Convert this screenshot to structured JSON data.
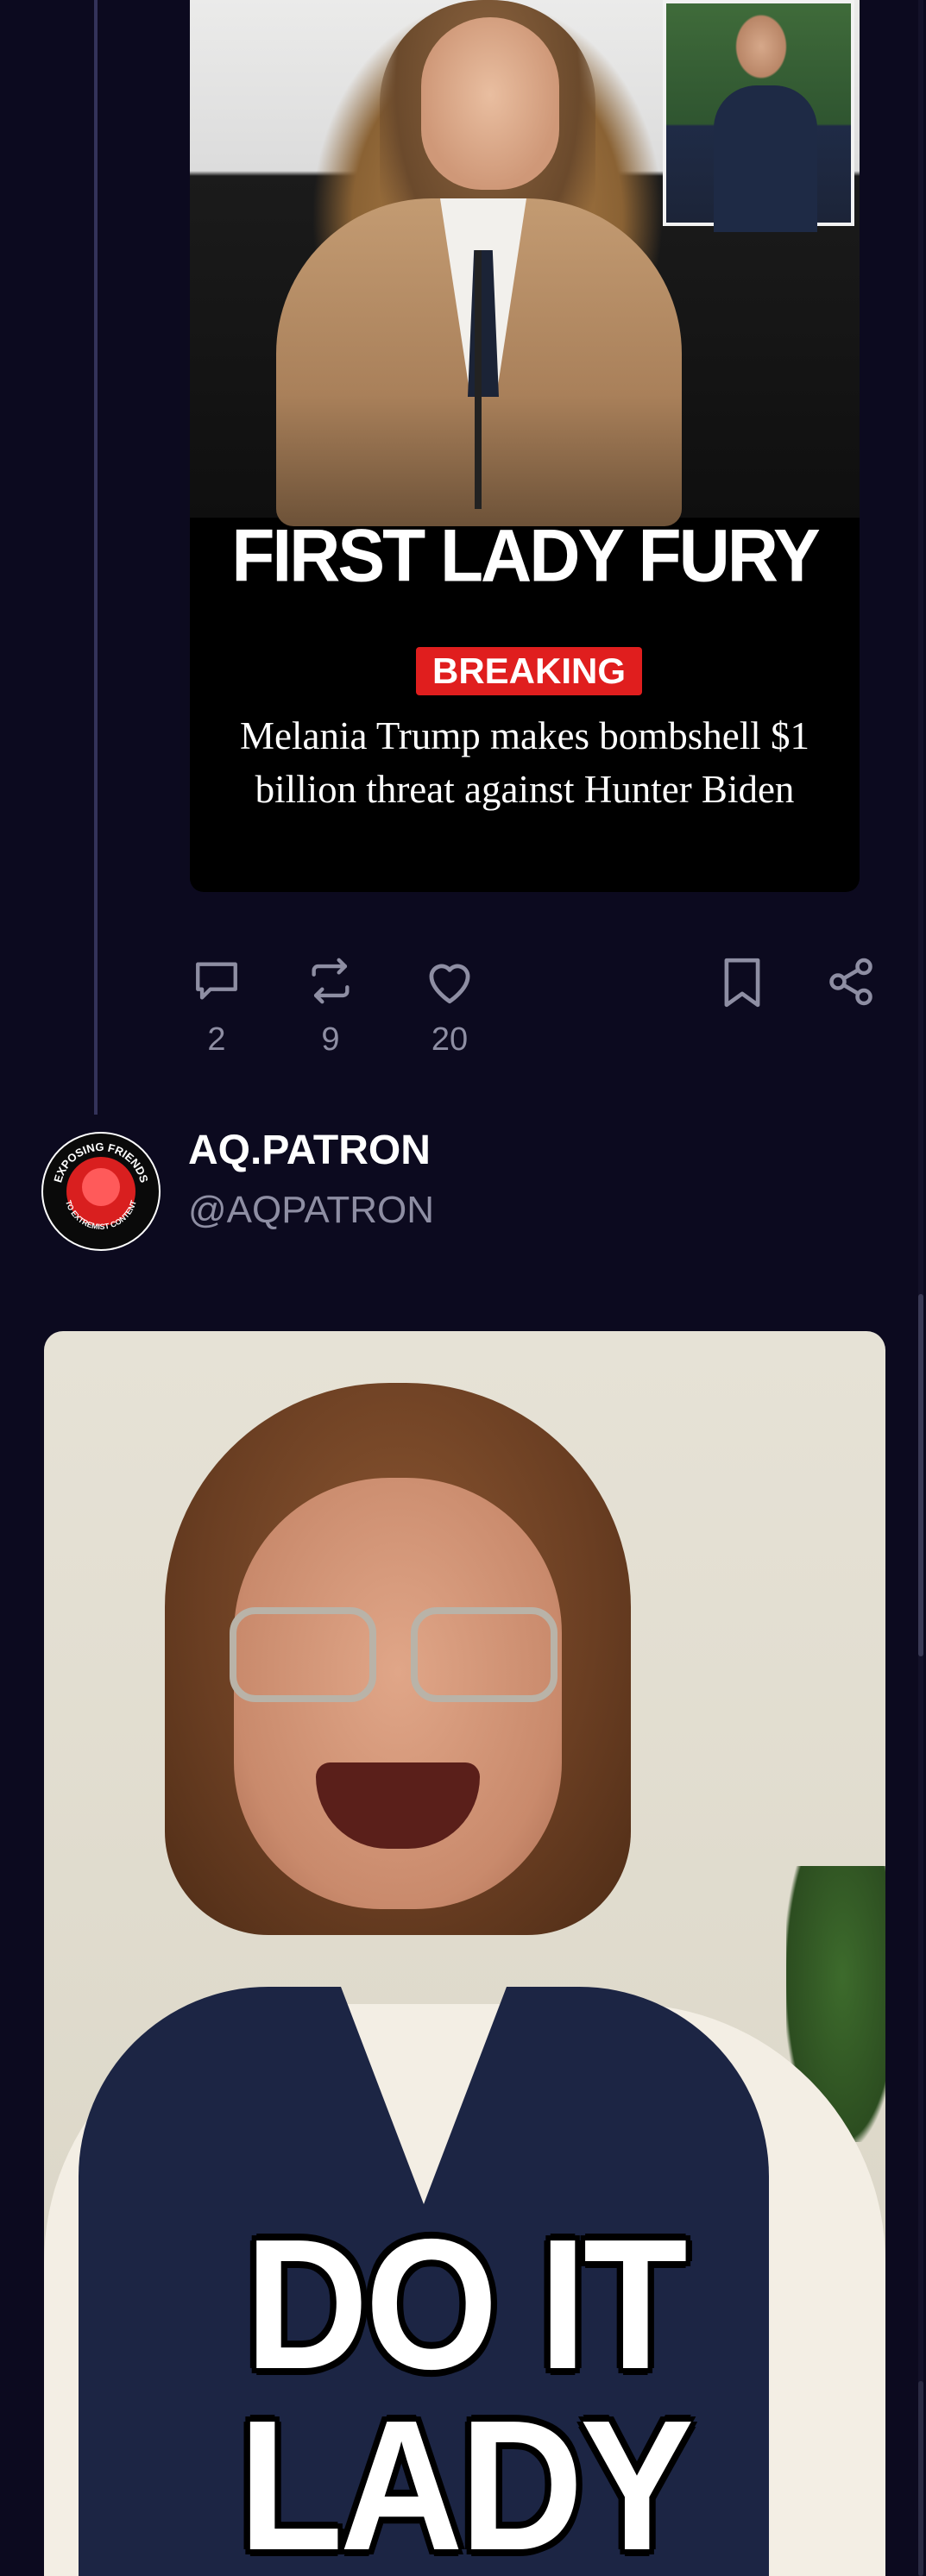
{
  "first_post": {
    "news_card": {
      "headline": "FIRST LADY FURY",
      "badge": "BREAKING",
      "summary": "Melania Trump makes bombshell $1 billion threat against Hunter Biden"
    },
    "actions": {
      "replies": "2",
      "reposts": "9",
      "likes": "20"
    }
  },
  "second_post": {
    "display_name": "AQ.PATRON",
    "handle": "@AQPATRON",
    "avatar_text": "EXPOSING FRIENDS TO EXTREMIST CONTENT",
    "meme": {
      "line1": "DO IT",
      "line2": "LADY"
    }
  },
  "colors": {
    "background": "#0c0a1f",
    "breaking_red": "#e01e1e",
    "muted_text": "#8e8ea3",
    "icon": "#8e8ea3"
  },
  "icons": [
    "reply-icon",
    "repost-icon",
    "like-icon",
    "bookmark-icon",
    "share-icon"
  ]
}
